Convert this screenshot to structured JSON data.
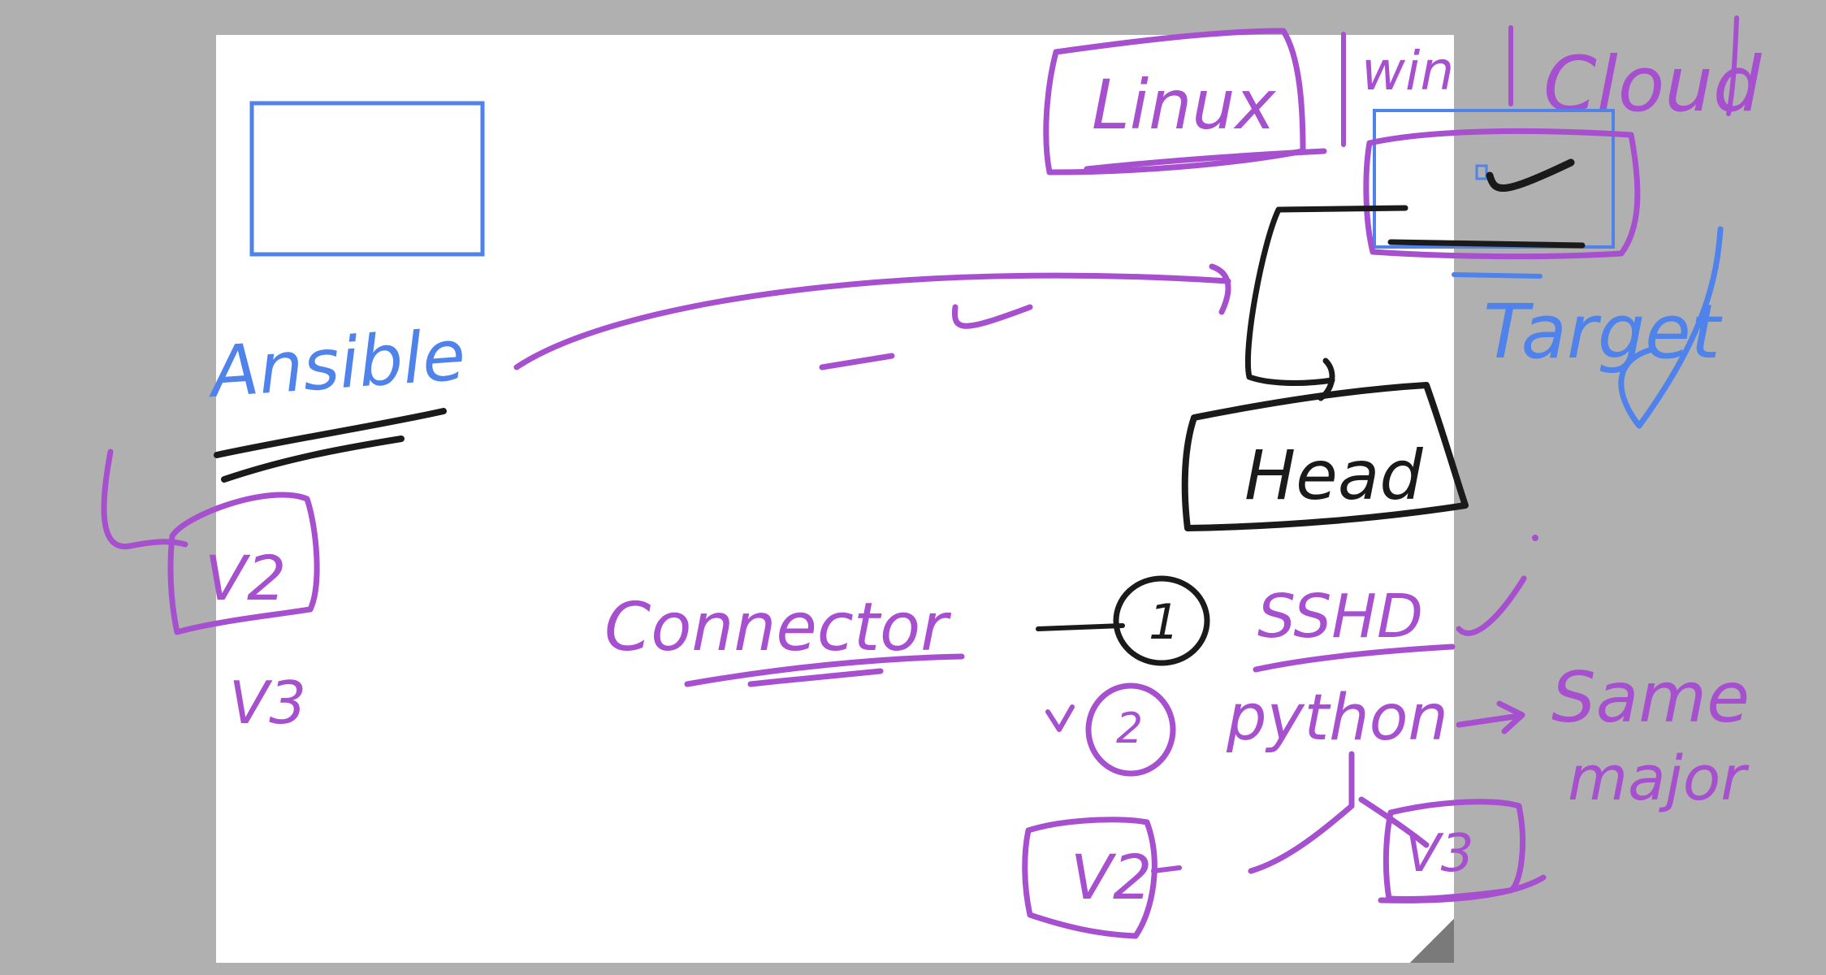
{
  "canvas": {
    "background": "#b0b0b0",
    "page_color": "#ffffff"
  },
  "colors": {
    "purple_ink": "#a64fcf",
    "blue_ink": "#4f82ea",
    "black_ink": "#1a1a1a"
  },
  "notes": {
    "ansible": "Ansible",
    "v2": "V2",
    "v3_left": "V3",
    "connector": "Connector",
    "linux": "Linux",
    "windows": "win",
    "cloud": "Cloud",
    "target": "Target",
    "head": "Head",
    "num_1": "1",
    "sshd": "SSHD",
    "num_2": "2",
    "python": "python",
    "same_major": "Same",
    "same_major_2": "major",
    "v2_box": "V2",
    "v3_box": "V3"
  }
}
